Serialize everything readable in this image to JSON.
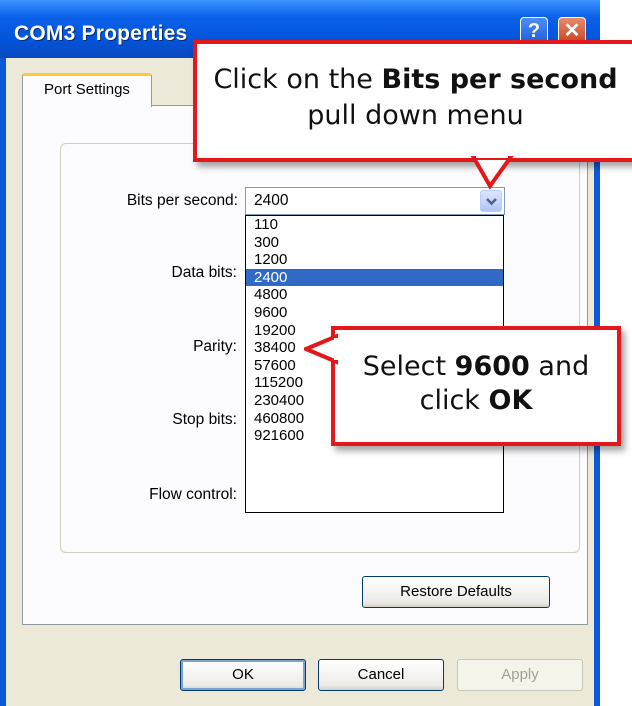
{
  "window": {
    "title": "COM3 Properties",
    "help_glyph": "?",
    "close_glyph": "✕"
  },
  "tabs": [
    {
      "label": "Port Settings",
      "active": true
    }
  ],
  "fields": {
    "bits_per_second_label": "Bits per second:",
    "data_bits_label": "Data bits:",
    "parity_label": "Parity:",
    "stop_bits_label": "Stop bits:",
    "flow_control_label": "Flow control:"
  },
  "bits_per_second": {
    "value": "2400",
    "options": [
      "110",
      "300",
      "1200",
      "2400",
      "4800",
      "9600",
      "19200",
      "38400",
      "57600",
      "115200",
      "230400",
      "460800",
      "921600"
    ],
    "highlighted": "2400"
  },
  "buttons": {
    "restore_defaults": "Restore Defaults",
    "ok": "OK",
    "cancel": "Cancel",
    "apply": "Apply"
  },
  "callouts": {
    "first": {
      "pre": "Click on the ",
      "bold": "Bits per second",
      "post": " pull down menu"
    },
    "second": {
      "pre": "Select ",
      "bold1": "9600",
      "mid": " and click ",
      "bold2": "OK"
    }
  },
  "colors": {
    "titlebar": "#0a5ad8",
    "selection": "#316ac5",
    "callout_border": "#e4171a",
    "dialog_face": "#ece9d8"
  },
  "icons": [
    "help-icon",
    "close-icon",
    "chevron-down-icon"
  ]
}
